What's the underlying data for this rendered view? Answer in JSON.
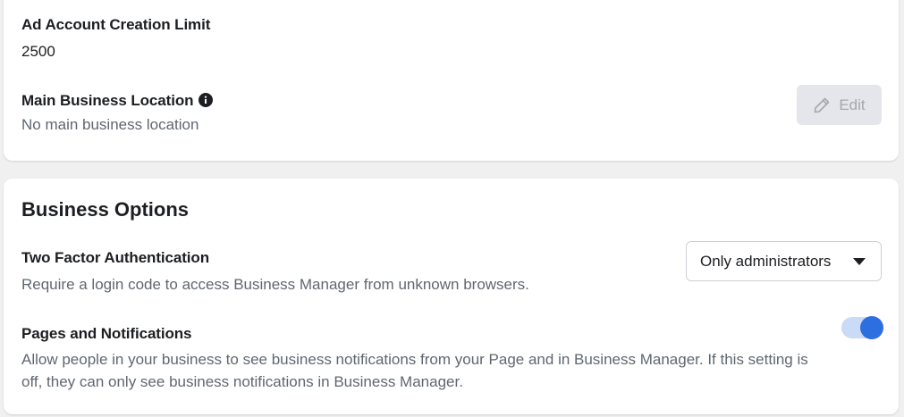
{
  "account": {
    "ad_limit_label": "Ad Account Creation Limit",
    "ad_limit_value": "2500",
    "location_label": "Main Business Location",
    "location_value": "No main business location",
    "edit_label": "Edit"
  },
  "business_options": {
    "title": "Business Options",
    "two_factor": {
      "label": "Two Factor Authentication",
      "description": "Require a login code to access Business Manager from unknown browsers.",
      "selected": "Only administrators"
    },
    "pages_notifications": {
      "label": "Pages and Notifications",
      "description": "Allow people in your business to see business notifications from your Page and in Business Manager. If this setting is off, they can only see business notifications in Business Manager.",
      "enabled": true
    }
  },
  "colors": {
    "toggle_on": "#2d6fe0",
    "toggle_track": "#c9dbf7",
    "disabled_button_bg": "#e4e6eb",
    "secondary_text": "#606770"
  },
  "icons": {
    "info": "info-icon",
    "edit": "pencil-icon",
    "dropdown": "caret-down-icon"
  }
}
